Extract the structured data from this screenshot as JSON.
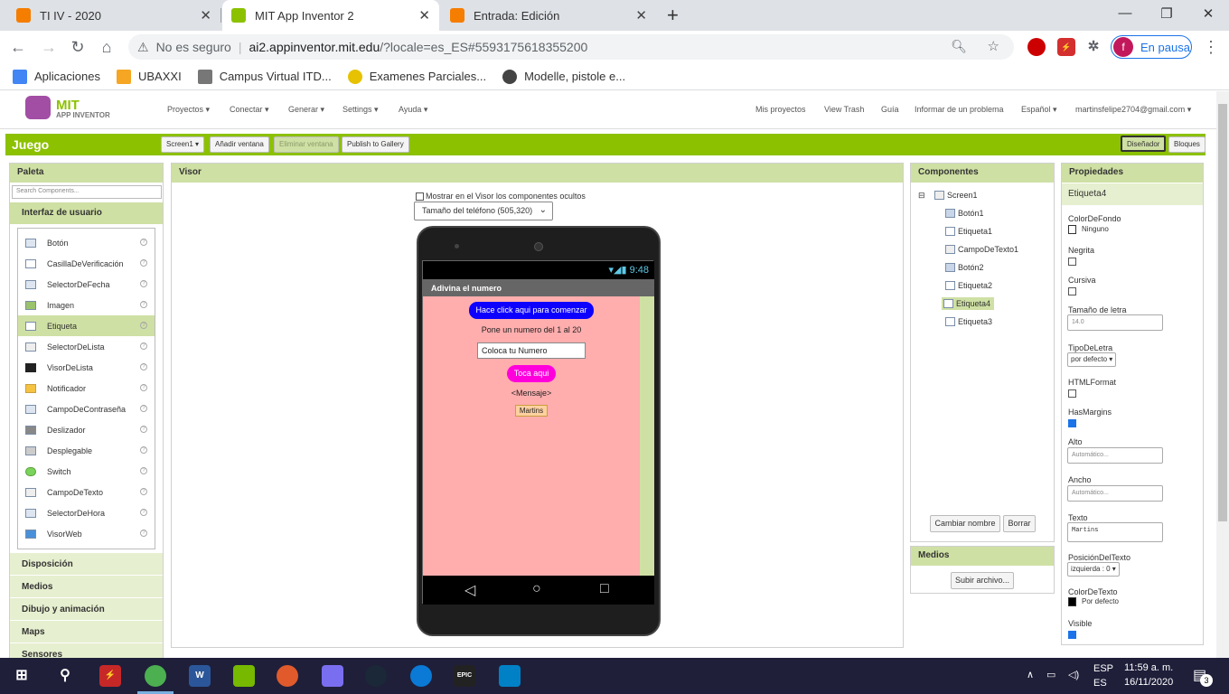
{
  "browser": {
    "tabs": [
      {
        "title": "TI IV - 2020",
        "favicon_color": "#f57d00",
        "active": false
      },
      {
        "title": "MIT App Inventor 2",
        "favicon_color": "#8cc100",
        "active": true
      },
      {
        "title": "Entrada: Edición",
        "favicon_color": "#f57d00",
        "active": false
      }
    ],
    "new_tab": "+",
    "security_label": "No es seguro",
    "url_host": "ai2.appinventor.mit.edu",
    "url_rest": "/?locale=es_ES#5593175618355200",
    "profile_initial": "f",
    "profile_label": "En pausa",
    "ext_abp": "ABP",
    "bookmarks": [
      {
        "label": "Aplicaciones",
        "color": "#4285f4"
      },
      {
        "label": "UBAXXI",
        "color": "#f5a623"
      },
      {
        "label": "Campus Virtual ITD...",
        "color": "#777777"
      },
      {
        "label": "Examenes Parciales...",
        "color": "#333333"
      },
      {
        "label": "Modelle, pistole e...",
        "color": "#444444"
      }
    ]
  },
  "app": {
    "logo_line1": "MIT",
    "logo_line2": "APP INVENTOR",
    "menus": [
      "Proyectos ▾",
      "Conectar ▾",
      "Generar ▾",
      "Settings ▾",
      "Ayuda ▾"
    ],
    "right_menus": [
      "Mis proyectos",
      "View Trash",
      "Guía",
      "Informar de un problema",
      "Español ▾",
      "martinsfelipe2704@gmail.com ▾"
    ],
    "project_name": "Juego",
    "screen_btn": "Screen1 ▾",
    "add_screen": "Añadir ventana",
    "remove_screen": "Eliminar ventana",
    "publish": "Publish to Gallery",
    "designer": "Diseñador",
    "blocks": "Bloques"
  },
  "palette": {
    "title": "Paleta",
    "search_placeholder": "Search Components...",
    "open_category": "Interfaz de usuario",
    "items": [
      "Botón",
      "CasillaDeVerificación",
      "SelectorDeFecha",
      "Imagen",
      "Etiqueta",
      "SelectorDeLista",
      "VisorDeLista",
      "Notificador",
      "CampoDeContraseña",
      "Deslizador",
      "Desplegable",
      "Switch",
      "CampoDeTexto",
      "SelectorDeHora",
      "VisorWeb"
    ],
    "selected": "Etiqueta",
    "help_glyph": "?",
    "categories": [
      "Disposición",
      "Medios",
      "Dibujo y animación",
      "Maps",
      "Sensores"
    ]
  },
  "viewer": {
    "title": "Visor",
    "hidden_checkbox_label": "Mostrar en el Visor los componentes ocultos",
    "size_select": "Tamaño del teléfono (505,320)",
    "time": "9:48",
    "app_title": "Adivina el numero",
    "start_button": "Hace click aqui para comenzar",
    "instruction": "Pone un numero del 1 al 20",
    "textbox_value": "Coloca tu Numero",
    "touch_button": "Toca aqui",
    "message": "<Mensaje>",
    "name_label": "Martins",
    "nav_back": "◁",
    "nav_home": "○",
    "nav_recent": "□"
  },
  "components": {
    "title": "Componentes",
    "collapse_glyph": "⊟",
    "root": "Screen1",
    "children": [
      "Botón1",
      "Etiqueta1",
      "CampoDeTexto1",
      "Botón2",
      "Etiqueta2",
      "Etiqueta4",
      "Etiqueta3"
    ],
    "selected": "Etiqueta4",
    "rename": "Cambiar nombre",
    "delete": "Borrar",
    "media_title": "Medios",
    "upload": "Subir archivo..."
  },
  "properties": {
    "title": "Propiedades",
    "component": "Etiqueta4",
    "bg_color_label": "ColorDeFondo",
    "bg_color_value": "Ninguno",
    "bold_label": "Negrita",
    "italic_label": "Cursiva",
    "font_size_label": "Tamaño de letra",
    "font_size_value": "14.0",
    "font_type_label": "TipoDeLetra",
    "font_type_value": "por defecto ▾",
    "html_label": "HTMLFormat",
    "margins_label": "HasMargins",
    "height_label": "Alto",
    "height_value": "Automático...",
    "width_label": "Ancho",
    "width_value": "Automático...",
    "text_label": "Texto",
    "text_value": "Martins",
    "text_pos_label": "PosiciónDelTexto",
    "text_pos_value": "izquierda : 0 ▾",
    "text_color_label": "ColorDeTexto",
    "text_color_value": "Por defecto",
    "visible_label": "Visible"
  },
  "taskbar": {
    "lang1": "ESP",
    "lang2": "ES",
    "time": "11:59 a. m.",
    "date": "16/11/2020",
    "notif_count": "3",
    "word_icon": "W",
    "epic_icon": "EPIC"
  }
}
